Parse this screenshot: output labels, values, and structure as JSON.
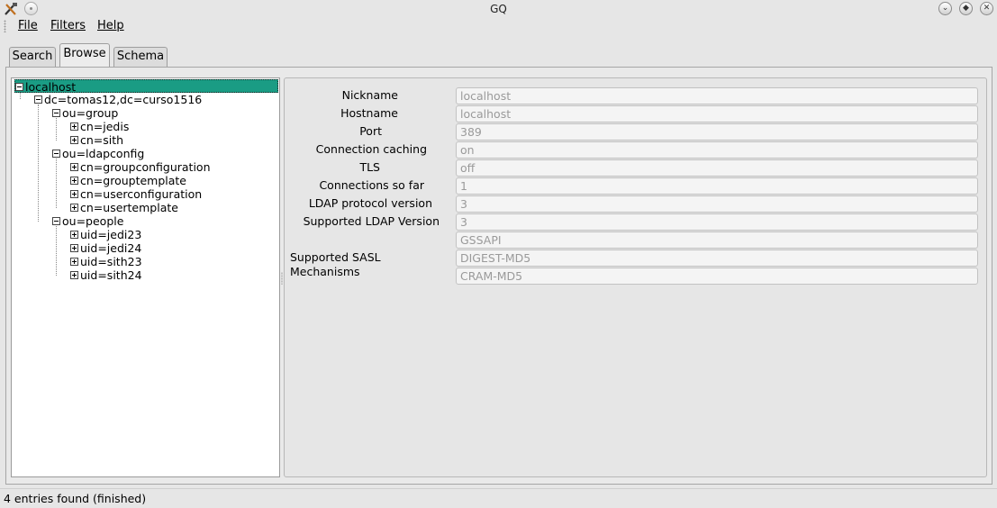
{
  "window": {
    "title": "GQ",
    "app_icon": "gq-app-icon",
    "controls": [
      "minimize-icon",
      "maximize-icon",
      "close-icon"
    ]
  },
  "menubar": {
    "file": "File",
    "filters": "Filters",
    "help": "Help"
  },
  "tabs": {
    "search": "Search",
    "browse": "Browse",
    "schema": "Schema",
    "active": "Browse"
  },
  "tree": {
    "root": "localhost",
    "base": "dc=tomas12,dc=curso1516",
    "ou_group": "ou=group",
    "cn_jedis": "cn=jedis",
    "cn_sith": "cn=sith",
    "ou_ldapconfig": "ou=ldapconfig",
    "cn_groupconfiguration": "cn=groupconfiguration",
    "cn_grouptemplate": "cn=grouptemplate",
    "cn_userconfiguration": "cn=userconfiguration",
    "cn_usertemplate": "cn=usertemplate",
    "ou_people": "ou=people",
    "uid_jedi23": "uid=jedi23",
    "uid_jedi24": "uid=jedi24",
    "uid_sith23": "uid=sith23",
    "uid_sith24": "uid=sith24"
  },
  "details": {
    "nickname_label": "Nickname",
    "nickname_value": "localhost",
    "hostname_label": "Hostname",
    "hostname_value": "localhost",
    "port_label": "Port",
    "port_value": "389",
    "caching_label": "Connection caching",
    "caching_value": "on",
    "tls_label": "TLS",
    "tls_value": "off",
    "connections_label": "Connections so far",
    "connections_value": "1",
    "protocol_label": "LDAP protocol version",
    "protocol_value": "3",
    "supported_label": "Supported LDAP Version",
    "supported_value": "3",
    "sasl_label": "Supported SASL Mechanisms",
    "sasl_1": "GSSAPI",
    "sasl_2": "DIGEST-MD5",
    "sasl_3": "CRAM-MD5"
  },
  "status": {
    "text": "4 entries found (finished)"
  },
  "colors": {
    "selection": "#1a9c84",
    "background": "#e6e6e6"
  }
}
